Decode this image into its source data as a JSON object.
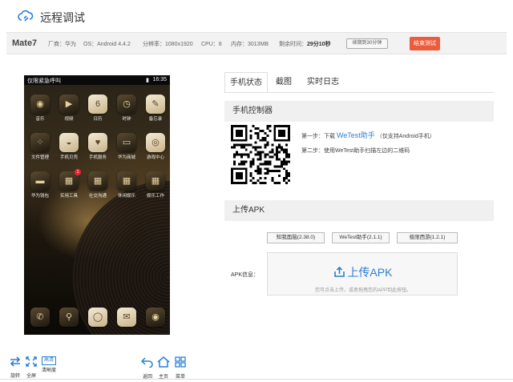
{
  "header": {
    "title": "远程调试",
    "logo_icon": "cloud-link-icon"
  },
  "infobar": {
    "model": "Mate7",
    "vendor_label": "厂商：",
    "vendor": "华为",
    "os_label": "OS：",
    "os": "Android 4.4.2",
    "resolution_label": "分辨率：",
    "resolution": "1080x1920",
    "cpu_label": "CPU：",
    "cpu": "8",
    "memory_label": "内存：",
    "memory": "3013MB",
    "remaining_label": "剩余时间：",
    "remaining": "29分10秒",
    "renew_button": "续期到30分钟",
    "end_button": "结束测试"
  },
  "phone": {
    "carrier": "仅限紧急呼叫",
    "time": "16:35",
    "apps_row1": [
      "音乐",
      "视频",
      "日历",
      "时钟",
      "备忘录"
    ],
    "apps_row2": [
      "文件管理",
      "手机贝壳",
      "手机服务",
      "华为商城",
      "游戏中心"
    ],
    "apps_row3": [
      "华为钱包",
      "实用工具",
      "社交沟通",
      "休闲娱乐",
      "娱乐工作"
    ],
    "badge": "1",
    "calendar_day": "6",
    "page_dots": 4
  },
  "tabs": [
    {
      "label": "手机状态",
      "active": true
    },
    {
      "label": "截图",
      "active": false
    },
    {
      "label": "实时日志",
      "active": false
    }
  ],
  "controller": {
    "title": "手机控制器",
    "step1_prefix": "第一步：下载",
    "step1_link": "WeTest助手",
    "step1_suffix": "（仅支持Android手机）",
    "step2": "第二步：使用WeTest助手扫描左边的二维码"
  },
  "upload_section": {
    "title": "上传APK",
    "versions": [
      "知我面脑(2.38.0)",
      "WeTest助手(2.1.1)",
      "极限西游(1.2.1)"
    ],
    "apk_label": "APK信息：",
    "upload_button": "上传APK",
    "hint": "您可点击上传，或者拖拽您的APP到此按钮。"
  },
  "toolbar": {
    "rotate": "旋转",
    "fullscreen": "全屏",
    "quality": "清晰度",
    "quality_badge": "高清",
    "back": "返回",
    "home": "主页",
    "menu": "菜单"
  },
  "colors": {
    "accent": "#2a7fd4",
    "danger": "#ec5c3c",
    "section_bg": "#f0f0f0"
  }
}
